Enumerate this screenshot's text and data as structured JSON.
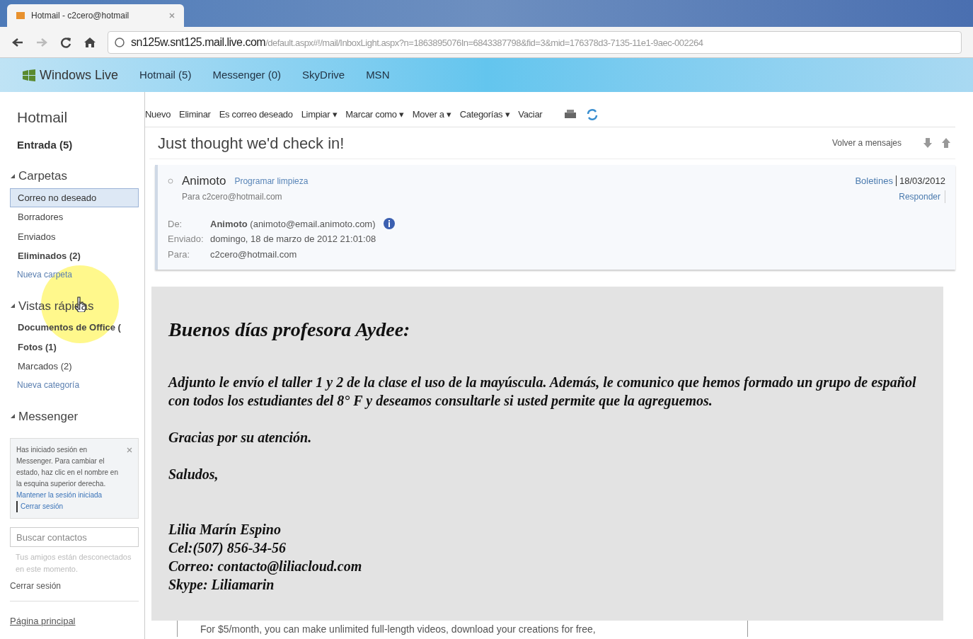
{
  "browser": {
    "tab_title": "Hotmail - c2cero@hotmail",
    "url_host": "sn125w.snt125.mail.live.com",
    "url_path": "/default.aspx#!/mail/InboxLight.aspx?n=1863895076In=6843387798&fid=3&mid=176378d3-7135-11e1-9aec-002264"
  },
  "top_nav": {
    "brand": "Windows Live",
    "items": [
      "Hotmail (5)",
      "Messenger (0)",
      "SkyDrive",
      "MSN"
    ]
  },
  "sidebar": {
    "title": "Hotmail",
    "inbox": "Entrada (5)",
    "sections": [
      {
        "title": "Carpetas",
        "expanded": true,
        "items": [
          {
            "label": "Correo no deseado",
            "selected": true,
            "bold": false
          },
          {
            "label": "Borradores",
            "selected": false,
            "bold": false
          },
          {
            "label": "Enviados",
            "selected": false,
            "bold": false
          },
          {
            "label": "Eliminados (2)",
            "selected": false,
            "bold": true
          }
        ],
        "new_link": "Nueva carpeta"
      },
      {
        "title": "Vistas rápidas",
        "expanded": true,
        "items": [
          {
            "label": "Documentos de Office (",
            "selected": false,
            "bold": true
          },
          {
            "label": "Fotos (1)",
            "selected": false,
            "bold": true
          },
          {
            "label": "Marcados (2)",
            "selected": false,
            "bold": false
          }
        ],
        "new_link": "Nueva categoría"
      },
      {
        "title": "Messenger",
        "expanded": true
      }
    ],
    "messenger_notice": "Has iniciado sesión en Messenger. Para cambiar el estado, haz clic en el nombre en la esquina superior derecha.",
    "messenger_links": [
      "Mantener la sesión iniciada",
      "Cerrar sesión"
    ],
    "contact_search": {
      "placeholder": "Buscar contactos"
    },
    "offline_note": "Tus amigos están desconectados en este momento.",
    "sign_out": "Cerrar sesión",
    "home": "Página principal"
  },
  "toolbar": [
    "Nuevo",
    "Eliminar",
    "Es correo deseado",
    "Limpiar ▾",
    "Marcar como ▾",
    "Mover a ▾",
    "Categorías ▾",
    "Vaciar"
  ],
  "message": {
    "subject": "Just thought we'd check in!",
    "back": "Volver a mensajes",
    "sender": "Animoto",
    "schedule_link": "Programar limpieza",
    "to_line": "Para c2cero@hotmail.com",
    "folder_link": "Boletines",
    "date": "18/03/2012",
    "reply": "Responder",
    "fields": [
      {
        "label": "De:",
        "value": "**Animoto** (animoto@email.animoto.com)",
        "info": true
      },
      {
        "label": "Enviado:",
        "value": "domingo, 18 de marzo de 2012 21:01:08",
        "info": false
      },
      {
        "label": "Para:",
        "value": "c2cero@hotmail.com",
        "info": false
      }
    ],
    "footer_line": "For $5/month, you can make unlimited full-length videos, download your creations for free,"
  },
  "letter": {
    "greeting": "Buenos días profesora Aydee:",
    "paragraphs": [
      "Adjunto le envío el taller 1 y 2 de la clase el uso de la mayúscula.  Además, le comunico que hemos formado un grupo de  español con todos los estudiantes del 8° F y deseamos consultarle si usted permite que la agreguemos.",
      "Gracias por su atención.",
      "Saludos,"
    ],
    "signature": [
      "Lilia Marín Espino",
      "Cel:(507) 856-34-56",
      "Correo: contacto@liliacloud.com",
      "Skype: Liliamarin"
    ]
  }
}
